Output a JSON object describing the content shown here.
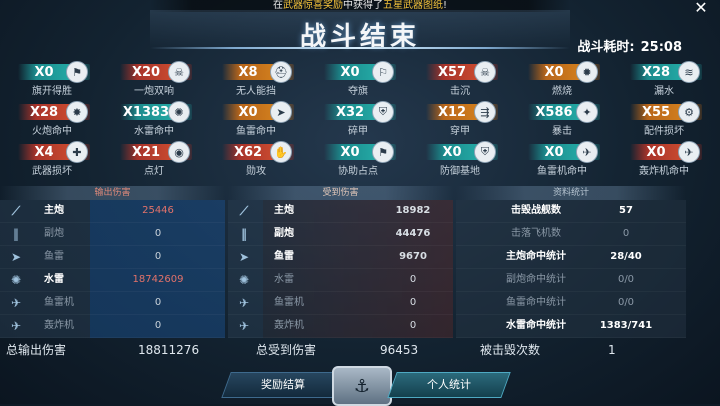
{
  "notice": {
    "prefix": "在",
    "highlight1": "武器惊喜奖励",
    "mid": "中获得了",
    "highlight2": "五星武器图纸",
    "suffix": "!"
  },
  "title": "战斗结束",
  "timer": {
    "label": "战斗耗时:",
    "value": "25:08"
  },
  "stats": [
    {
      "value": "X0",
      "label": "旗开得胜",
      "color": "teal",
      "icon": "flag-icon"
    },
    {
      "value": "X20",
      "label": "一炮双响",
      "color": "red",
      "icon": "skull-icon"
    },
    {
      "value": "X8",
      "label": "无人能挡",
      "color": "orange",
      "icon": "helmet-icon"
    },
    {
      "value": "X0",
      "label": "夺旗",
      "color": "teal",
      "icon": "flag-capture-icon"
    },
    {
      "value": "X57",
      "label": "击沉",
      "color": "red",
      "icon": "skull-icon"
    },
    {
      "value": "X0",
      "label": "燃烧",
      "color": "orange",
      "icon": "fire-icon"
    },
    {
      "value": "X28",
      "label": "漏水",
      "color": "teal",
      "icon": "water-icon"
    },
    {
      "value": "X28",
      "label": "火炮命中",
      "color": "red",
      "icon": "cannon-icon"
    },
    {
      "value": "X1383",
      "label": "水雷命中",
      "color": "teal",
      "icon": "mine-icon"
    },
    {
      "value": "X0",
      "label": "鱼雷命中",
      "color": "orange",
      "icon": "torpedo-icon"
    },
    {
      "value": "X32",
      "label": "碎甲",
      "color": "teal",
      "icon": "shield-crack-icon"
    },
    {
      "value": "X12",
      "label": "穿甲",
      "color": "orange",
      "icon": "pierce-icon"
    },
    {
      "value": "X586",
      "label": "暴击",
      "color": "teal",
      "icon": "crit-icon"
    },
    {
      "value": "X55",
      "label": "配件损坏",
      "color": "orange",
      "icon": "gear-icon"
    },
    {
      "value": "X4",
      "label": "武器损坏",
      "color": "red",
      "icon": "gun-icon"
    },
    {
      "value": "X21",
      "label": "点灯",
      "color": "red",
      "icon": "lamp-icon"
    },
    {
      "value": "X62",
      "label": "勋攻",
      "color": "red",
      "icon": "hand-icon"
    },
    {
      "value": "X0",
      "label": "协助占点",
      "color": "teal",
      "icon": "flag-icon"
    },
    {
      "value": "X0",
      "label": "防御基地",
      "color": "teal",
      "icon": "shield-icon"
    },
    {
      "value": "X0",
      "label": "鱼雷机命中",
      "color": "teal",
      "icon": "plane-icon"
    },
    {
      "value": "X0",
      "label": "轰炸机命中",
      "color": "red",
      "icon": "bomber-icon"
    }
  ],
  "output": {
    "header": "输出伤害",
    "rows": [
      {
        "name": "主炮",
        "value": "25446",
        "state": "on",
        "icon": "main-gun-icon"
      },
      {
        "name": "副炮",
        "value": "0",
        "state": "off",
        "icon": "secondary-gun-icon"
      },
      {
        "name": "鱼雷",
        "value": "0",
        "state": "off",
        "icon": "torpedo-icon"
      },
      {
        "name": "水雷",
        "value": "18742609",
        "state": "on",
        "icon": "mine-icon"
      },
      {
        "name": "鱼雷机",
        "value": "0",
        "state": "off",
        "icon": "torpedo-plane-icon"
      },
      {
        "name": "轰炸机",
        "value": "0",
        "state": "off",
        "icon": "bomber-icon"
      }
    ],
    "total_label": "总输出伤害",
    "total_value": "18811276"
  },
  "received": {
    "header": "受到伤害",
    "rows": [
      {
        "name": "主炮",
        "value": "18982",
        "state": "on",
        "icon": "main-gun-icon"
      },
      {
        "name": "副炮",
        "value": "44476",
        "state": "on",
        "icon": "secondary-gun-icon"
      },
      {
        "name": "鱼雷",
        "value": "9670",
        "state": "on",
        "icon": "torpedo-icon"
      },
      {
        "name": "水雷",
        "value": "0",
        "state": "off",
        "icon": "mine-icon"
      },
      {
        "name": "鱼雷机",
        "value": "0",
        "state": "off",
        "icon": "torpedo-plane-icon"
      },
      {
        "name": "轰炸机",
        "value": "0",
        "state": "off",
        "icon": "bomber-icon"
      }
    ],
    "total_label": "总受到伤害",
    "total_value": "96453"
  },
  "summary": {
    "header": "资料统计",
    "rows": [
      {
        "name": "击毁战舰数",
        "value": "57",
        "state": "on"
      },
      {
        "name": "击落飞机数",
        "value": "0",
        "state": "off"
      },
      {
        "name": "主炮命中统计",
        "value": "28/40",
        "state": "on"
      },
      {
        "name": "副炮命中统计",
        "value": "0/0",
        "state": "off"
      },
      {
        "name": "鱼雷命中统计",
        "value": "0/0",
        "state": "off"
      },
      {
        "name": "水雷命中统计",
        "value": "1383/741",
        "state": "on"
      }
    ],
    "total_label": "被击毁次数",
    "total_value": "1"
  },
  "buttons": {
    "reward": "奖励结算",
    "personal": "个人统计"
  }
}
